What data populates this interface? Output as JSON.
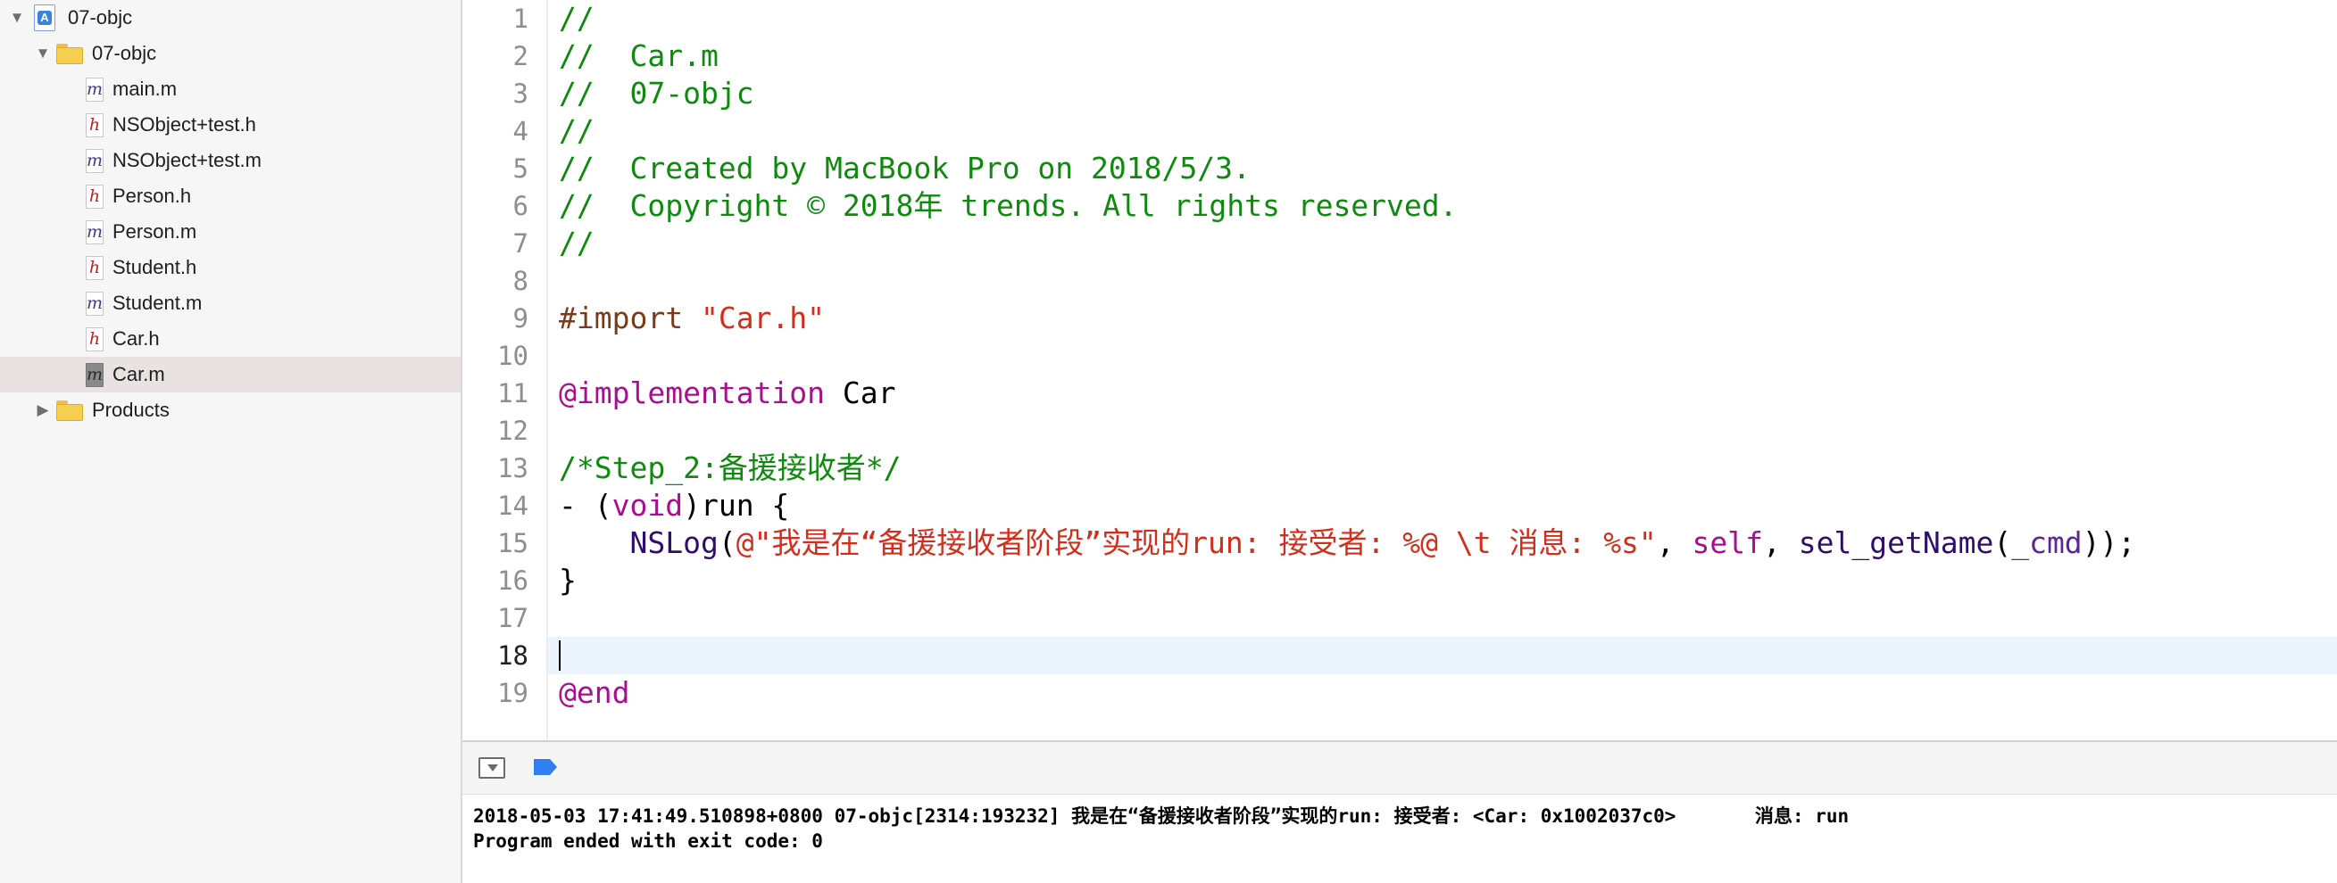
{
  "navigator": {
    "project": {
      "name": "07-objc"
    },
    "group": {
      "name": "07-objc"
    },
    "files": [
      {
        "name": "main.m",
        "type": "m"
      },
      {
        "name": "NSObject+test.h",
        "type": "h"
      },
      {
        "name": "NSObject+test.m",
        "type": "m"
      },
      {
        "name": "Person.h",
        "type": "h"
      },
      {
        "name": "Person.m",
        "type": "m"
      },
      {
        "name": "Student.h",
        "type": "h"
      },
      {
        "name": "Student.m",
        "type": "m"
      },
      {
        "name": "Car.h",
        "type": "h"
      },
      {
        "name": "Car.m",
        "type": "m",
        "selected": true
      }
    ],
    "products": {
      "name": "Products"
    }
  },
  "editor": {
    "current_line": 18,
    "lines": [
      {
        "no": "1",
        "tokens": [
          {
            "t": "//",
            "c": "comment"
          }
        ]
      },
      {
        "no": "2",
        "tokens": [
          {
            "t": "//  Car.m",
            "c": "comment"
          }
        ]
      },
      {
        "no": "3",
        "tokens": [
          {
            "t": "//  07-objc",
            "c": "comment"
          }
        ]
      },
      {
        "no": "4",
        "tokens": [
          {
            "t": "//",
            "c": "comment"
          }
        ]
      },
      {
        "no": "5",
        "tokens": [
          {
            "t": "//  Created by MacBook Pro on 2018/5/3.",
            "c": "comment"
          }
        ]
      },
      {
        "no": "6",
        "tokens": [
          {
            "t": "//  Copyright © 2018年 trends. All rights reserved.",
            "c": "comment"
          }
        ]
      },
      {
        "no": "7",
        "tokens": [
          {
            "t": "//",
            "c": "comment"
          }
        ]
      },
      {
        "no": "8",
        "tokens": []
      },
      {
        "no": "9",
        "tokens": [
          {
            "t": "#import ",
            "c": "pre"
          },
          {
            "t": "\"Car.h\"",
            "c": "string"
          }
        ]
      },
      {
        "no": "10",
        "tokens": []
      },
      {
        "no": "11",
        "tokens": [
          {
            "t": "@implementation",
            "c": "keyword"
          },
          {
            "t": " Car",
            "c": "plain"
          }
        ]
      },
      {
        "no": "12",
        "tokens": []
      },
      {
        "no": "13",
        "tokens": [
          {
            "t": "/*Step_2:备援接收者*/",
            "c": "comment"
          }
        ]
      },
      {
        "no": "14",
        "tokens": [
          {
            "t": "- (",
            "c": "plain"
          },
          {
            "t": "void",
            "c": "keyword"
          },
          {
            "t": ")run {",
            "c": "plain"
          }
        ]
      },
      {
        "no": "15",
        "tokens": [
          {
            "t": "    ",
            "c": "plain"
          },
          {
            "t": "NSLog",
            "c": "func"
          },
          {
            "t": "(",
            "c": "plain"
          },
          {
            "t": "@\"我是在“备援接收者阶段”实现的run: 接受者: %@ \\t 消息: %s\"",
            "c": "string"
          },
          {
            "t": ", ",
            "c": "plain"
          },
          {
            "t": "self",
            "c": "keyword"
          },
          {
            "t": ", ",
            "c": "plain"
          },
          {
            "t": "sel_getName",
            "c": "func"
          },
          {
            "t": "(",
            "c": "plain"
          },
          {
            "t": "_cmd",
            "c": "other"
          },
          {
            "t": "));",
            "c": "plain"
          }
        ]
      },
      {
        "no": "16",
        "tokens": [
          {
            "t": "}",
            "c": "plain"
          }
        ]
      },
      {
        "no": "17",
        "tokens": []
      },
      {
        "no": "18",
        "tokens": []
      },
      {
        "no": "19",
        "tokens": [
          {
            "t": "@end",
            "c": "keyword"
          }
        ]
      }
    ]
  },
  "debug": {
    "toggle_icon": "hide-debug-area-icon",
    "breakpoint_icon": "breakpoints-icon",
    "breakpoint_color": "#2f7ff0"
  },
  "console": {
    "lines": [
      "2018-05-03 17:41:49.510898+0800 07-objc[2314:193232] 我是在“备援接收者阶段”实现的run: 接受者: <Car: 0x1002037c0>       消息: run",
      "Program ended with exit code: 0"
    ]
  }
}
